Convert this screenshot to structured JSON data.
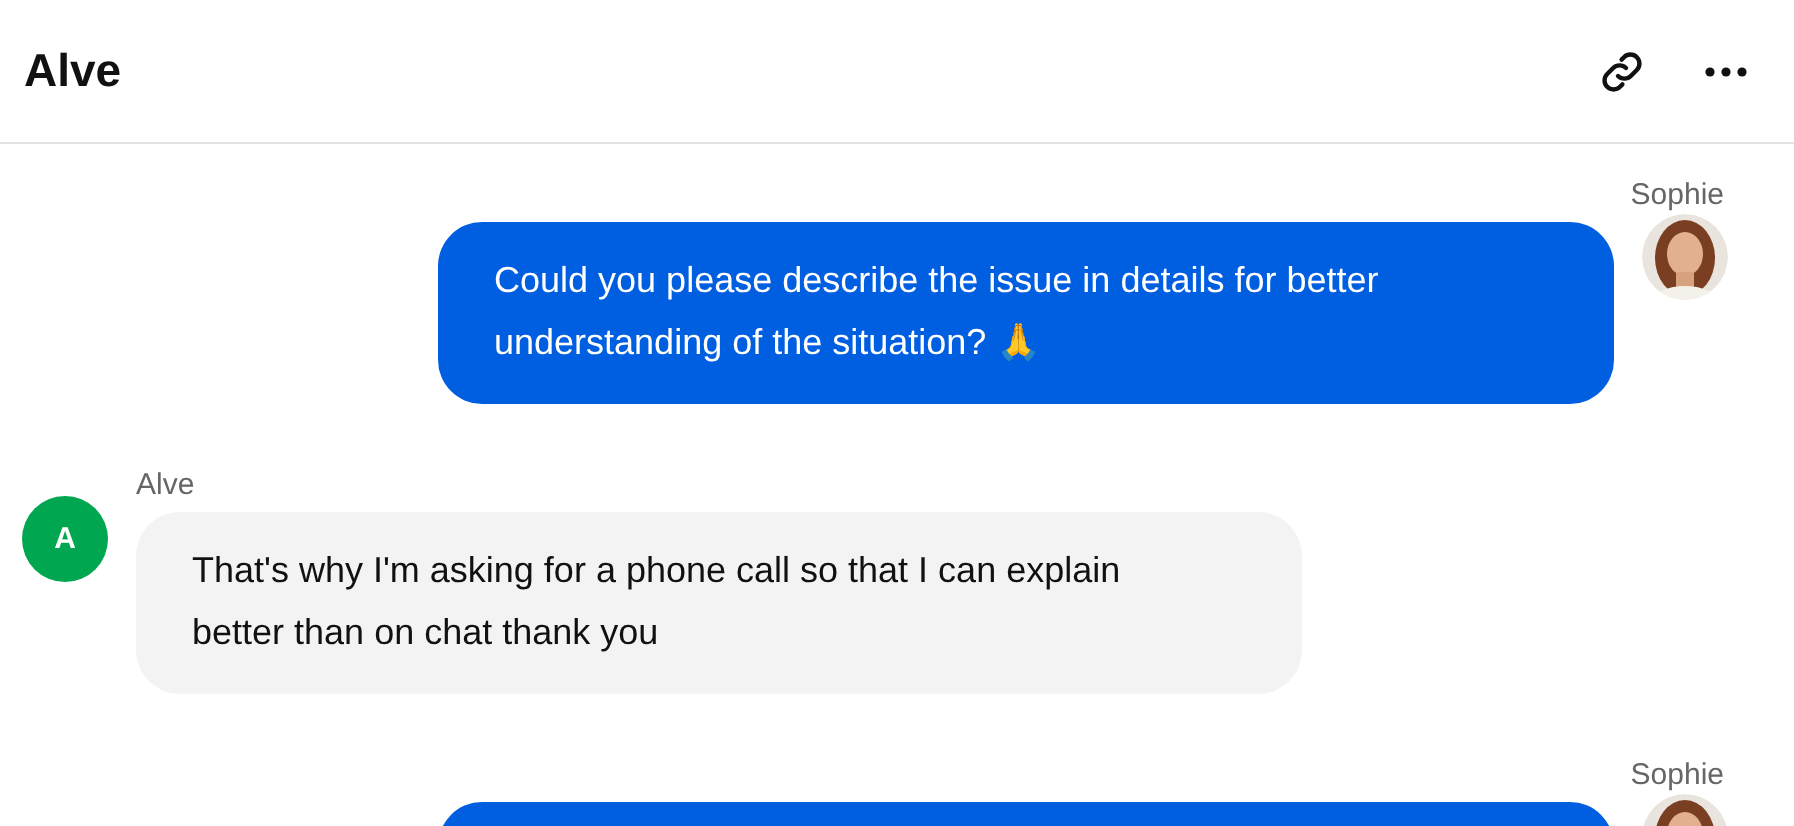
{
  "header": {
    "title": "Alve"
  },
  "messages": [
    {
      "kind": "outgoing",
      "sender": "Sophie",
      "text": "Could you please describe the issue in details for better understanding of the situation? 🙏"
    },
    {
      "kind": "incoming",
      "sender": "Alve",
      "avatar_initial": "A",
      "color": "#00a650",
      "text": "That's why I'm asking for a phone call so that I can explain better than on chat thank you"
    },
    {
      "kind": "outgoing",
      "sender": "Sophie"
    }
  ]
}
